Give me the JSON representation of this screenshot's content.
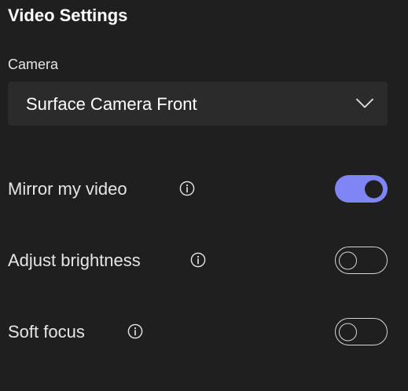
{
  "panel": {
    "title": "Video Settings"
  },
  "camera": {
    "label": "Camera",
    "selected": "Surface Camera Front",
    "chevron_icon": "chevron-down-icon"
  },
  "settings": [
    {
      "label": "Mirror my video",
      "info_icon": "info-icon",
      "enabled": true
    },
    {
      "label": "Adjust brightness",
      "info_icon": "info-icon",
      "enabled": false
    },
    {
      "label": "Soft focus",
      "info_icon": "info-icon",
      "enabled": false
    }
  ],
  "colors": {
    "background": "#1f1f1f",
    "dropdown": "#2b2b2b",
    "accent": "#7f85f5",
    "text": "#ffffff",
    "muted_text": "#e6e6e6"
  }
}
